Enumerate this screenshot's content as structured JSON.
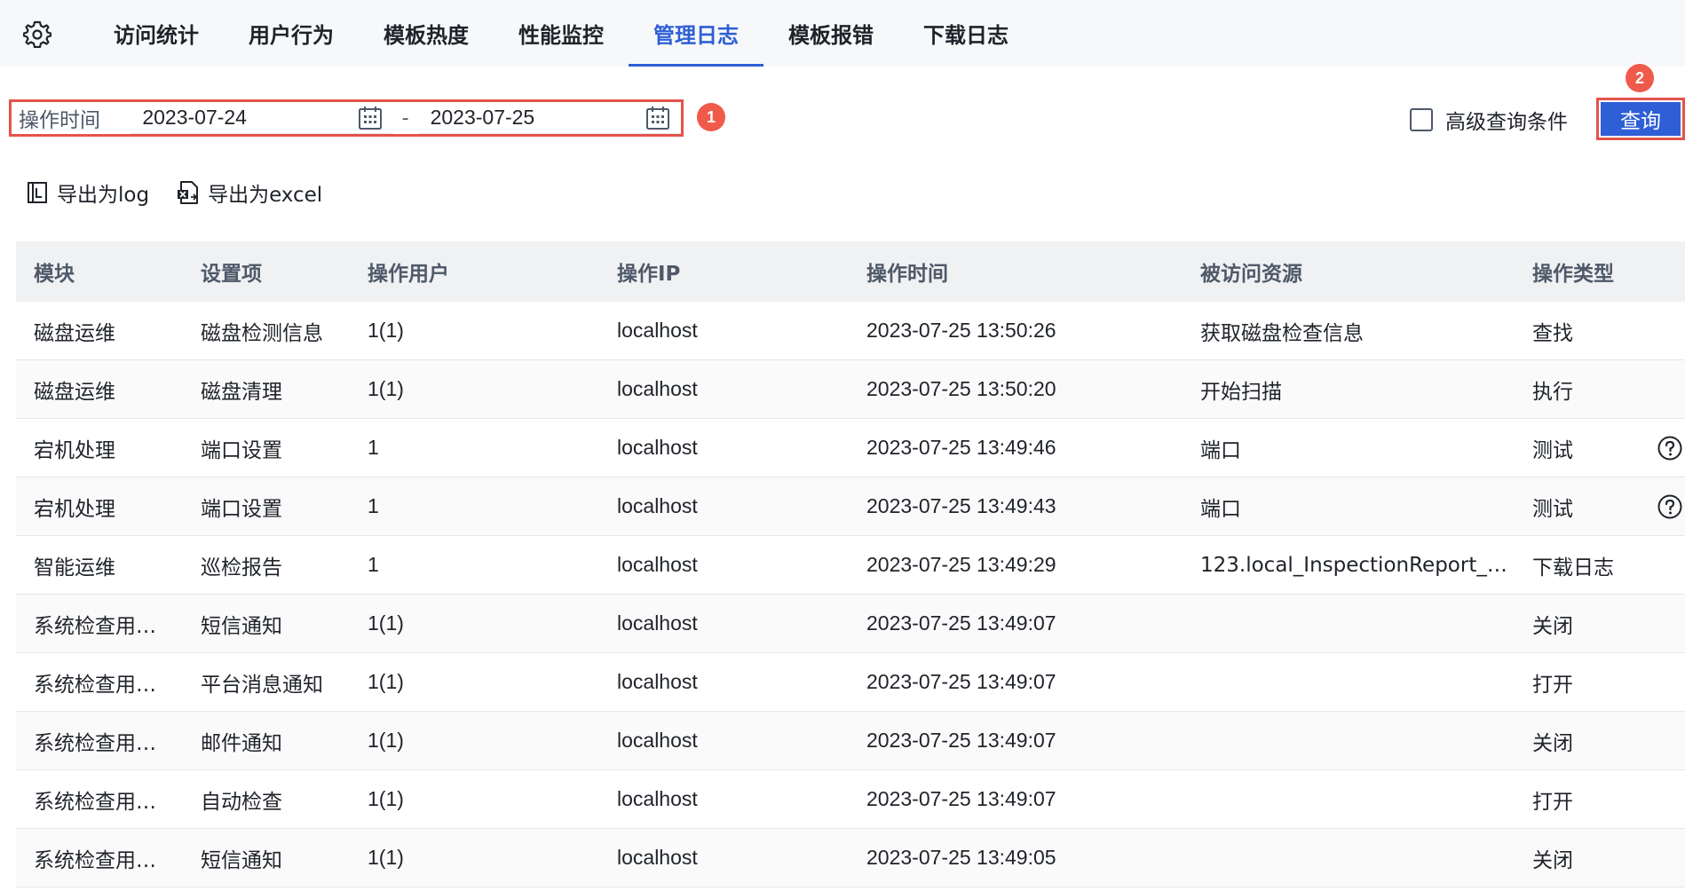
{
  "nav": {
    "tabs": [
      {
        "label": "访问统计"
      },
      {
        "label": "用户行为"
      },
      {
        "label": "模板热度"
      },
      {
        "label": "性能监控"
      },
      {
        "label": "管理日志"
      },
      {
        "label": "模板报错"
      },
      {
        "label": "下载日志"
      }
    ],
    "active_tab": "管理日志",
    "icon": "gear-icon"
  },
  "filter": {
    "date_label": "操作时间",
    "start_date": "2023-07-24",
    "separator": "-",
    "end_date": "2023-07-25",
    "advanced_label": "高级查询条件",
    "advanced_checked": false,
    "query_button": "查询",
    "step_badges": [
      "1",
      "2"
    ]
  },
  "exports": {
    "log_label": "导出为log",
    "excel_label": "导出为excel"
  },
  "table": {
    "columns": [
      "模块",
      "设置项",
      "操作用户",
      "操作IP",
      "操作时间",
      "被访问资源",
      "操作类型"
    ],
    "rows": [
      {
        "module": "磁盘运维",
        "setting": "磁盘检测信息",
        "user": "1(1)",
        "ip": "localhost",
        "time": "2023-07-25 13:50:26",
        "resource": "获取磁盘检查信息",
        "type": "查找",
        "help": false
      },
      {
        "module": "磁盘运维",
        "setting": "磁盘清理",
        "user": "1(1)",
        "ip": "localhost",
        "time": "2023-07-25 13:50:20",
        "resource": "开始扫描",
        "type": "执行",
        "help": false
      },
      {
        "module": "宕机处理",
        "setting": "端口设置",
        "user": "1",
        "ip": "localhost",
        "time": "2023-07-25 13:49:46",
        "resource": "端口",
        "type": "测试",
        "help": true
      },
      {
        "module": "宕机处理",
        "setting": "端口设置",
        "user": "1",
        "ip": "localhost",
        "time": "2023-07-25 13:49:43",
        "resource": "端口",
        "type": "测试",
        "help": true
      },
      {
        "module": "智能运维",
        "setting": "巡检报告",
        "user": "1",
        "ip": "localhost",
        "time": "2023-07-25 13:49:29",
        "resource": "123.local_InspectionReport_2…",
        "type": "下载日志",
        "help": false
      },
      {
        "module": "系统检查用…",
        "setting": "短信通知",
        "user": "1(1)",
        "ip": "localhost",
        "time": "2023-07-25 13:49:07",
        "resource": "",
        "type": "关闭",
        "help": false
      },
      {
        "module": "系统检查用…",
        "setting": "平台消息通知",
        "user": "1(1)",
        "ip": "localhost",
        "time": "2023-07-25 13:49:07",
        "resource": "",
        "type": "打开",
        "help": false
      },
      {
        "module": "系统检查用…",
        "setting": "邮件通知",
        "user": "1(1)",
        "ip": "localhost",
        "time": "2023-07-25 13:49:07",
        "resource": "",
        "type": "关闭",
        "help": false
      },
      {
        "module": "系统检查用…",
        "setting": "自动检查",
        "user": "1(1)",
        "ip": "localhost",
        "time": "2023-07-25 13:49:07",
        "resource": "",
        "type": "打开",
        "help": false
      },
      {
        "module": "系统检查用…",
        "setting": "短信通知",
        "user": "1(1)",
        "ip": "localhost",
        "time": "2023-07-25 13:49:05",
        "resource": "",
        "type": "关闭",
        "help": false
      }
    ]
  },
  "colors": {
    "accent": "#2f5fd6",
    "annotation": "#e5534b",
    "badge": "#ef5a4a"
  }
}
